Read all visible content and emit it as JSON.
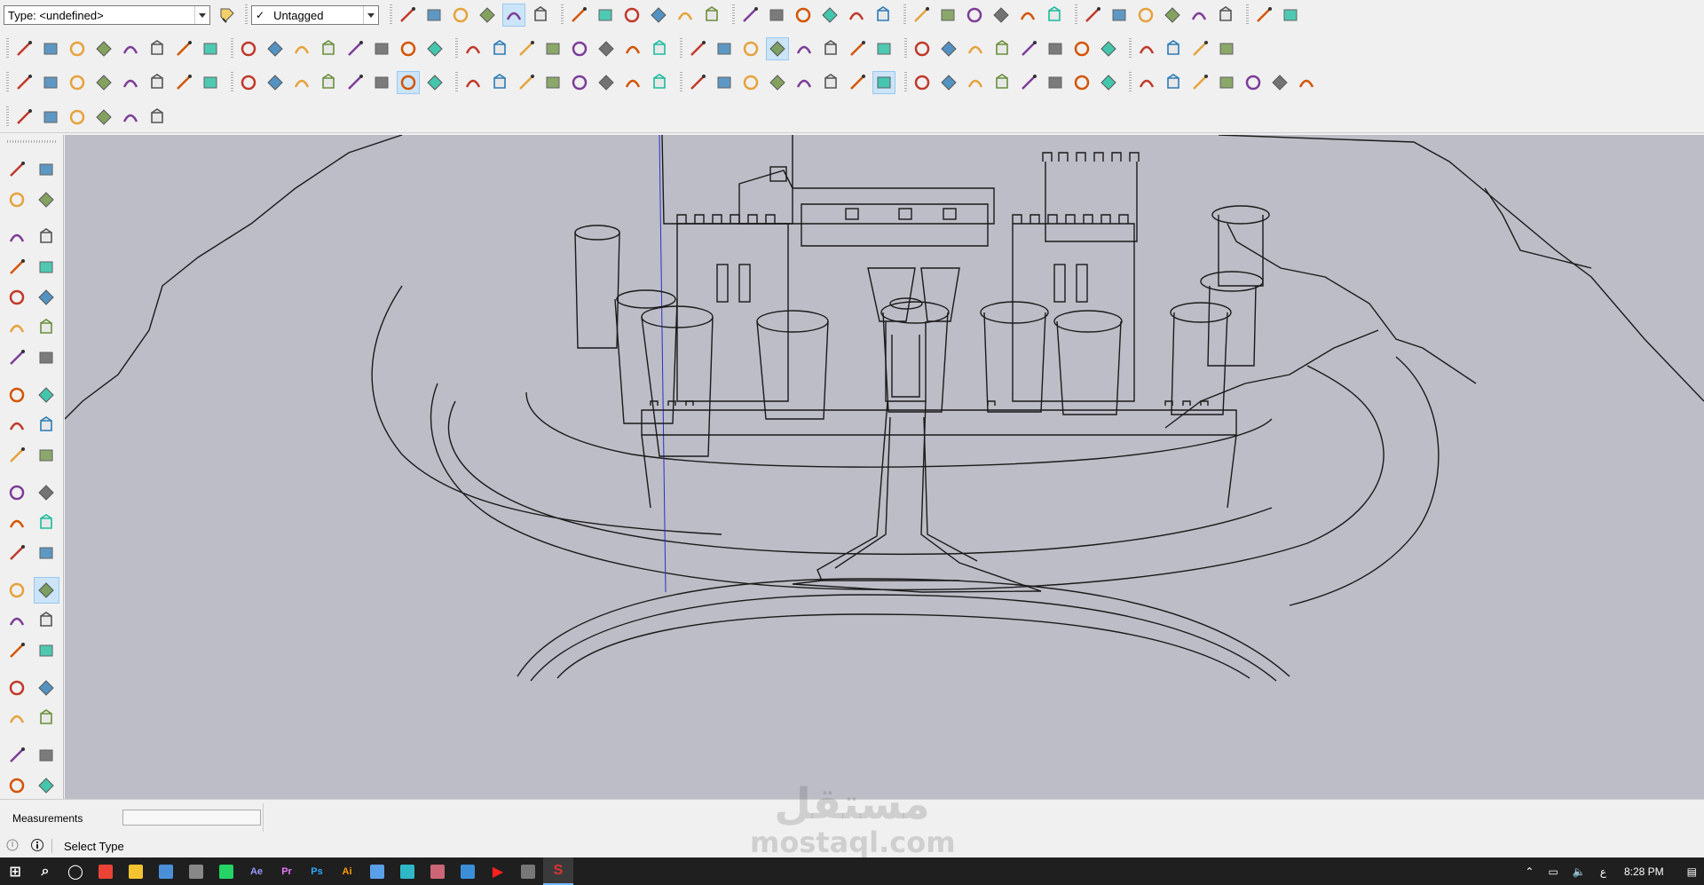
{
  "toolbar": {
    "type_combo": {
      "value": "Type: <undefined>"
    },
    "tag_combo": {
      "value": "Untagged",
      "checked_mark": "✓"
    }
  },
  "icons": {
    "row1": [
      "tag-editor-icon",
      "iso-view-icon",
      "front-view-icon",
      "top-view-icon",
      "right-view-icon",
      "back-view-icon",
      "left-view-icon",
      "bottom-view-icon",
      "xray-icon",
      "back-edges-icon",
      "wireframe-icon",
      "hidden-line-icon",
      "shaded-icon",
      "shaded-texture-icon",
      "monochrome-icon",
      "section-plane-icon",
      "display-section-icon",
      "section-cut-icon",
      "warehouse-icon",
      "extension-icon",
      "components-icon",
      "house-front-icon",
      "house-side-icon",
      "house-outline-icon",
      "house-garage-icon",
      "camera-icon",
      "walk-icon",
      "photo-match-icon",
      "sandbox-icon",
      "cloud-icon",
      "sync-icon",
      "close-red-icon"
    ],
    "row2": [
      "select-icon",
      "make-component-icon",
      "paint-bucket-icon",
      "eraser-icon",
      "line-icon",
      "freehand-icon",
      "rectangle-icon",
      "rotated-rectangle-icon",
      "circle-icon",
      "polygon-icon",
      "arc-icon",
      "two-point-arc-icon",
      "three-point-arc-icon",
      "pie-icon",
      "move-icon",
      "push-pull-icon",
      "rotate-icon",
      "follow-me-icon",
      "scale-icon",
      "offset-icon",
      "tape-measure-icon",
      "dimension-icon",
      "protractor-icon",
      "text-icon",
      "axes-icon",
      "3d-text-icon",
      "orbit-icon",
      "pan-icon",
      "zoom-icon",
      "zoom-window-icon",
      "zoom-extents-icon",
      "previous-view-icon",
      "position-camera-icon",
      "look-around-icon",
      "walk-footprints-icon",
      "section-icon",
      "xray-cube-icon",
      "back-edges-cube-icon",
      "shaded-cube-icon",
      "solid-tools-icon",
      "model-info-icon",
      "upload-icon",
      "share-icon",
      "add-location-icon"
    ],
    "row3": [
      "select-icon",
      "eraser-icon",
      "pencil-icon",
      "arc-icon",
      "circle-icon",
      "push-pull-icon",
      "follow-me-icon",
      "move-icon",
      "rotate-icon",
      "scale-icon",
      "tape-measure-icon",
      "text-icon",
      "paint-icon",
      "orbit-icon",
      "pan-icon",
      "zoom-icon",
      "zoom-extents-icon",
      "warehouse-icon",
      "extension-icon",
      "share-model-icon",
      "ruby-icon",
      "user-icon",
      "layers-icon",
      "outliner-icon",
      "intersect-icon",
      "union-icon",
      "subtract-icon",
      "trim-icon",
      "split-icon",
      "solid-inspector-icon",
      "check-icon",
      "teapot-icon",
      "cloud-icon",
      "refresh-icon",
      "dimension-grid-icon",
      "view-icon",
      "scene-icon",
      "camera-icon",
      "lock-icon",
      "sun-icon",
      "shadow-icon",
      "fog-icon",
      "edge-icon",
      "protractor-icon",
      "axis-icon",
      "star-icon",
      "dome-icon"
    ],
    "row4": [
      "sandbox-from-contours-icon",
      "sandbox-from-scratch-icon",
      "smoove-icon",
      "stamp-icon",
      "drape-icon",
      "add-detail-icon"
    ],
    "left": [
      [
        "select-icon",
        "make-component-icon"
      ],
      [
        "paint-bucket-icon",
        "eraser-icon"
      ],
      [
        "line-icon",
        "freehand-icon"
      ],
      [
        "rectangle-icon",
        "rotated-rectangle-icon"
      ],
      [
        "circle-icon",
        "polygon-icon"
      ],
      [
        "arc-icon",
        "two-point-arc-icon"
      ],
      [
        "three-point-arc-icon",
        "pie-icon"
      ],
      [
        "move-icon",
        "push-pull-icon"
      ],
      [
        "rotate-icon",
        "follow-me-icon"
      ],
      [
        "scale-icon",
        "offset-icon"
      ],
      [
        "tape-measure-icon",
        "dimension-icon"
      ],
      [
        "protractor-icon",
        "text-icon"
      ],
      [
        "axes-icon",
        "3d-text-icon"
      ],
      [
        "orbit-icon",
        "pan-icon"
      ],
      [
        "zoom-icon",
        "zoom-window-icon"
      ],
      [
        "zoom-extents-icon",
        "previous-view-icon"
      ],
      [
        "position-camera-icon",
        "look-around-icon"
      ],
      [
        "walk-icon",
        "section-plane-icon"
      ],
      [
        "warehouse-icon",
        "extension-warehouse-icon"
      ],
      [
        "share-component-icon",
        "ruby-icon"
      ]
    ]
  },
  "colors": {
    "viewport_bg": "#bcbdc6",
    "line": "#1a1a1a",
    "axis_blue": "#2d2dc8",
    "taskbar": "#1f1f1f"
  },
  "measurements": {
    "label": "Measurements",
    "value": ""
  },
  "status": {
    "text": "Select Type"
  },
  "watermark": {
    "arabic": "مستقل",
    "latin": "mostaql.com"
  },
  "taskbar": {
    "apps": [
      "windows-start-icon",
      "search-icon",
      "task-view-icon",
      "chrome-icon",
      "file-explorer-icon",
      "calculator-icon",
      "pen-app-icon",
      "whatsapp-icon",
      "after-effects-icon",
      "premiere-icon",
      "photoshop-icon",
      "illustrator-icon",
      "app-icon",
      "app-icon",
      "app-icon",
      "app-icon",
      "youtube-icon",
      "app-icon",
      "sketchup-icon"
    ],
    "app_labels": [
      "⊞",
      "⌕",
      "◯",
      "",
      "",
      "",
      "",
      "",
      "Ae",
      "Pr",
      "Ps",
      "Ai",
      "",
      "",
      "",
      "",
      "▶",
      "",
      "S"
    ],
    "tray_lang": "ع",
    "clock": "8:28 PM"
  }
}
